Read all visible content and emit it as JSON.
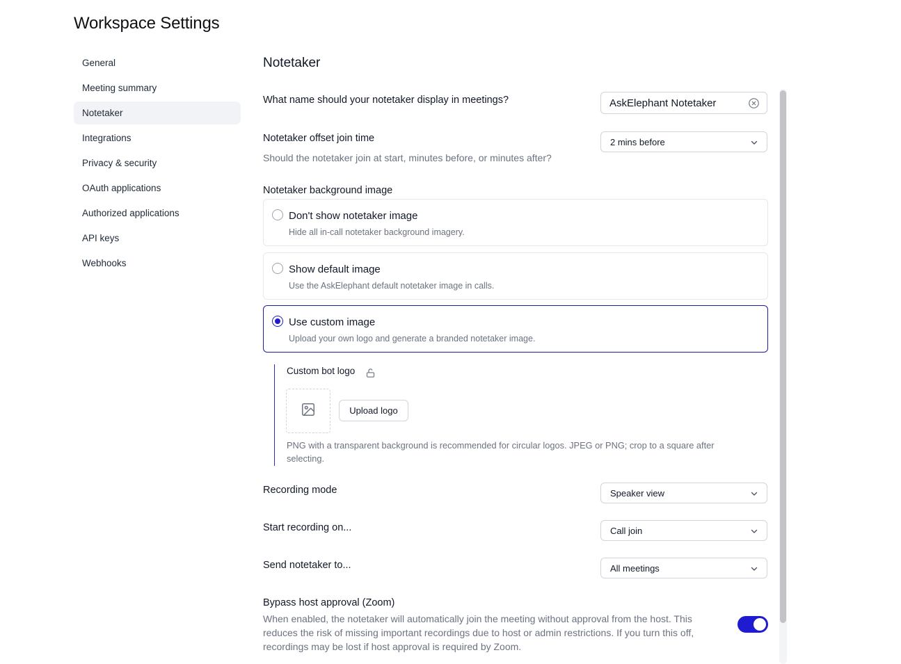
{
  "page": {
    "title": "Workspace Settings"
  },
  "sidebar": {
    "items": [
      {
        "label": "General"
      },
      {
        "label": "Meeting summary"
      },
      {
        "label": "Notetaker",
        "active": true
      },
      {
        "label": "Integrations"
      },
      {
        "label": "Privacy & security"
      },
      {
        "label": "OAuth applications"
      },
      {
        "label": "Authorized applications"
      },
      {
        "label": "API keys"
      },
      {
        "label": "Webhooks"
      }
    ]
  },
  "main": {
    "section_title": "Notetaker",
    "display_name": {
      "label": "What name should your notetaker display in meetings?",
      "value": "AskElephant Notetaker"
    },
    "offset_join": {
      "label": "Notetaker offset join time",
      "help": "Should the notetaker join at start, minutes before, or minutes after?",
      "selected": "2 mins before"
    },
    "background_image": {
      "label": "Notetaker background image",
      "options": [
        {
          "title": "Don't show notetaker image",
          "desc": "Hide all in-call notetaker background imagery.",
          "selected": false
        },
        {
          "title": "Show default image",
          "desc": "Use the AskElephant default notetaker image in calls.",
          "selected": false
        },
        {
          "title": "Use custom image",
          "desc": "Upload your own logo and generate a branded notetaker image.",
          "selected": true
        }
      ],
      "custom_logo": {
        "label": "Custom bot logo",
        "upload_label": "Upload logo",
        "help": "PNG with a transparent background is recommended for circular logos. JPEG or PNG; crop to a square after selecting."
      }
    },
    "recording_mode": {
      "label": "Recording mode",
      "selected": "Speaker view"
    },
    "start_recording": {
      "label": "Start recording on...",
      "selected": "Call join"
    },
    "send_notetaker": {
      "label": "Send notetaker to...",
      "selected": "All meetings"
    },
    "bypass_host": {
      "label": "Bypass host approval (Zoom)",
      "desc": "When enabled, the notetaker will automatically join the meeting without approval from the host. This reduces the risk of missing important recordings due to host or admin restrictions. If you turn this off, recordings may be lost if host approval is required by Zoom.",
      "enabled": true
    }
  },
  "colors": {
    "accent": "#1f1bd1",
    "selected_border": "#1e1aa8",
    "nav_active_bg": "#f1f3f7",
    "muted_text": "#6b7280"
  },
  "icons": {
    "clear": "x-circle-icon",
    "chevron": "chevron-down-icon",
    "lock": "unlock-icon",
    "image": "image-icon"
  }
}
